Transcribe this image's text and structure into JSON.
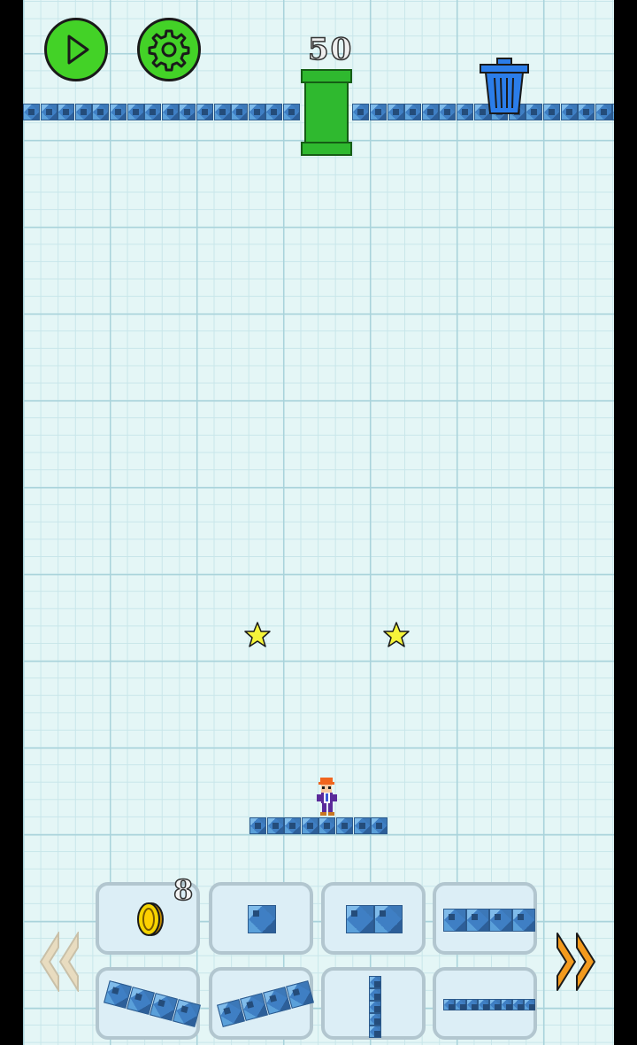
{
  "toolbar": {
    "play_icon": "play-icon",
    "settings_icon": "gear-icon",
    "trash_icon": "trash-can-icon",
    "score": "50"
  },
  "colors": {
    "button_green": "#43d227",
    "pipe_green": "#2fb92f",
    "block_blue": "#3f7fc4",
    "star_yellow": "#f5f53a",
    "arrow_orange": "#f39a1d",
    "arrow_disabled": "#e8dcc0",
    "trash_blue": "#2b7de9"
  },
  "level": {
    "stars": 2,
    "character": "player-character"
  },
  "palette": {
    "prev_arrow": "previous-page-arrow",
    "next_arrow": "next-page-arrow",
    "items": [
      {
        "name": "coin",
        "count": "8"
      },
      {
        "name": "single-block"
      },
      {
        "name": "double-block"
      },
      {
        "name": "quad-block-row"
      },
      {
        "name": "slanted-ramp-down"
      },
      {
        "name": "slanted-ramp-up"
      },
      {
        "name": "vertical-column"
      },
      {
        "name": "long-thin-row"
      }
    ]
  }
}
